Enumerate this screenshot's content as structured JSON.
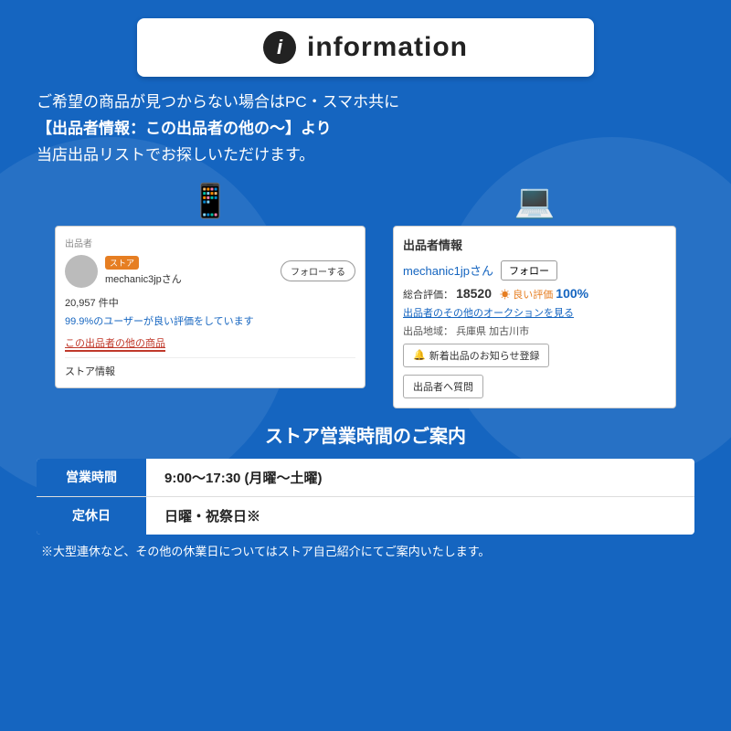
{
  "header": {
    "info_icon_text": "i",
    "title": "information"
  },
  "description": {
    "line1": "ご希望の商品が見つからない場合はPC・スマホ共に",
    "line2": "【出品者情報：この出品者の他の〜】より",
    "line3": "当店出品リストでお探しいただけます。"
  },
  "mobile_screenshot": {
    "section_label": "出品者",
    "store_badge": "ストア",
    "seller_name": "mechanic3jpさん",
    "follow_button": "フォローする",
    "stats_count": "20,957 件中",
    "stats_percent": "99.9%のユーザーが良い評価をしています",
    "other_items_link": "この出品者の他の商品",
    "store_info": "ストア情報"
  },
  "pc_screenshot": {
    "section_label": "出品者情報",
    "seller_name": "mechanic1jpさん",
    "follow_button": "フォロー",
    "rating_label": "総合評価：",
    "rating_count": "18520",
    "rating_good_label": "良い評価",
    "rating_percent": "100%",
    "auction_link": "出品者のその他のオークションを見る",
    "location_label": "出品地域：",
    "location": "兵庫県 加古川市",
    "notify_button": "新着出品のお知らせ登録",
    "question_button": "出品者へ質問"
  },
  "store_hours": {
    "title": "ストア営業時間のご案内",
    "rows": [
      {
        "label": "営業時間",
        "value": "9:00〜17:30 (月曜〜土曜)"
      },
      {
        "label": "定休日",
        "value": "日曜・祝祭日※"
      }
    ],
    "footnote": "※大型連休など、その他の休業日についてはストア自己紹介にてご案内いたします。"
  }
}
